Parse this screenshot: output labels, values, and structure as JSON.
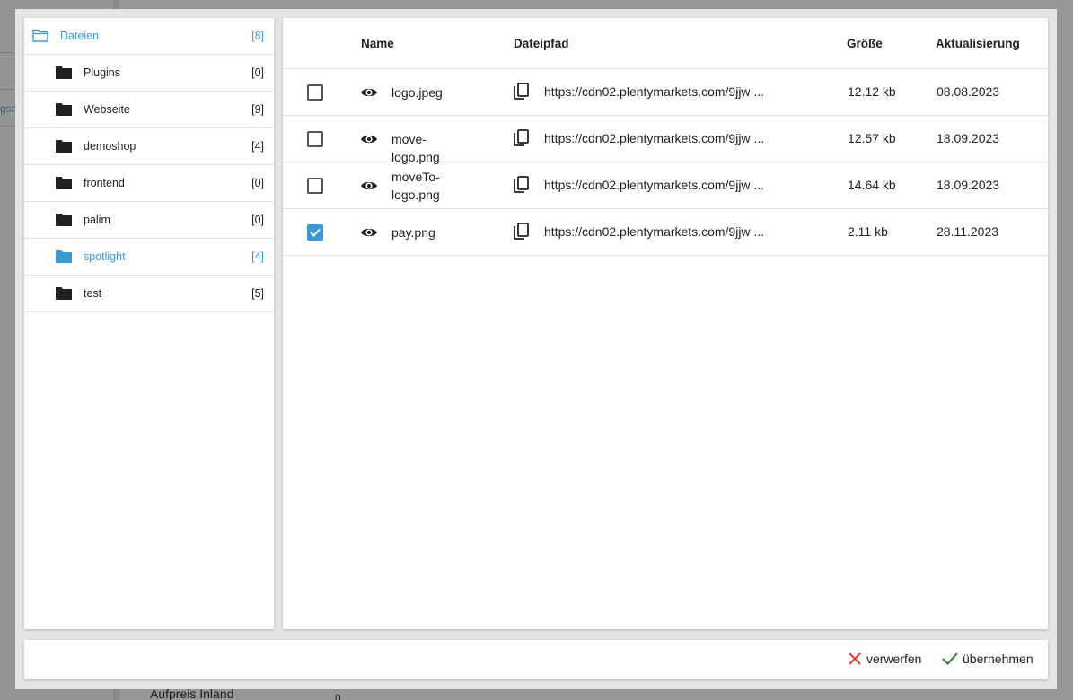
{
  "background": {
    "side_link": "gsa",
    "bottom_label": "Aufpreis Inland",
    "bottom_value": "0"
  },
  "folders": [
    {
      "name": "Dateien",
      "count": "[8]",
      "level": "root",
      "active": true,
      "icon": "folder-outline-icon"
    },
    {
      "name": "Plugins",
      "count": "[0]",
      "level": "child",
      "active": false,
      "icon": "folder-icon"
    },
    {
      "name": "Webseite",
      "count": "[9]",
      "level": "child",
      "active": false,
      "icon": "folder-icon"
    },
    {
      "name": "demoshop",
      "count": "[4]",
      "level": "child",
      "active": false,
      "icon": "folder-icon"
    },
    {
      "name": "frontend",
      "count": "[0]",
      "level": "child",
      "active": false,
      "icon": "folder-icon"
    },
    {
      "name": "palim",
      "count": "[0]",
      "level": "child",
      "active": false,
      "icon": "folder-icon"
    },
    {
      "name": "spotlight",
      "count": "[4]",
      "level": "child",
      "active": true,
      "icon": "folder-icon"
    },
    {
      "name": "test",
      "count": "[5]",
      "level": "child",
      "active": false,
      "icon": "folder-icon"
    }
  ],
  "table": {
    "headers": {
      "name": "Name",
      "path": "Dateipfad",
      "size": "Größe",
      "updated": "Aktualisierung"
    },
    "rows": [
      {
        "checked": false,
        "name": "logo.jpeg",
        "path": "https://cdn02.plentymarkets.com/9jjw ...",
        "size": "12.12 kb",
        "updated": "08.08.2023"
      },
      {
        "checked": false,
        "name": "move-logo.png",
        "path": "https://cdn02.plentymarkets.com/9jjw ...",
        "size": "12.57 kb",
        "updated": "18.09.2023"
      },
      {
        "checked": false,
        "name": "moveTo-logo.png",
        "name_lines": [
          "moveTo-",
          "logo.png"
        ],
        "path": "https://cdn02.plentymarkets.com/9jjw ...",
        "size": "14.64 kb",
        "updated": "18.09.2023"
      },
      {
        "checked": true,
        "name": "pay.png",
        "path": "https://cdn02.plentymarkets.com/9jjw ...",
        "size": "2.11 kb",
        "updated": "28.11.2023"
      }
    ]
  },
  "footer": {
    "discard_label": "verwerfen",
    "apply_label": "übernehmen"
  },
  "colors": {
    "accent": "#3a9ad9",
    "discard": "#e53935",
    "apply": "#2e7d32"
  }
}
